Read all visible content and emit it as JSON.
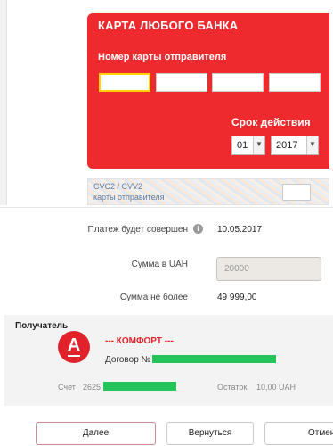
{
  "card": {
    "title": "КАРТА ЛЮБОГО БАНКА",
    "number_label": "Номер карты отправителя",
    "number_fields": [
      "",
      "",
      "",
      ""
    ],
    "expiry_label": "Срок действия",
    "expiry_month": "01",
    "expiry_year": "2017"
  },
  "cvc": {
    "line1": "CVC2 / CVV2",
    "line2": "карты отправителя",
    "value": ""
  },
  "payment": {
    "date_label": "Платеж будет совершен",
    "date_value": "10.05.2017",
    "amount_label": "Сумма в UAH",
    "amount_value": "20000",
    "max_label": "Сумма не более",
    "max_value": "49 999,00"
  },
  "recipient": {
    "title": "Получатель",
    "logo_letter": "А",
    "name": "--- КОМФОРТ ---",
    "contract_label": "Договор №",
    "account_label": "Счет",
    "account_prefix": "2625",
    "balance_label": "Остаток",
    "balance_value": "10,00 UAH"
  },
  "buttons": {
    "next": "Далее",
    "back": "Вернуться",
    "cancel": "Отмен"
  },
  "colors": {
    "card_red": "#ef2a2f",
    "highlight_yellow": "#ffd400",
    "mask_green": "#25c45a",
    "logo_red": "#e1222b"
  }
}
